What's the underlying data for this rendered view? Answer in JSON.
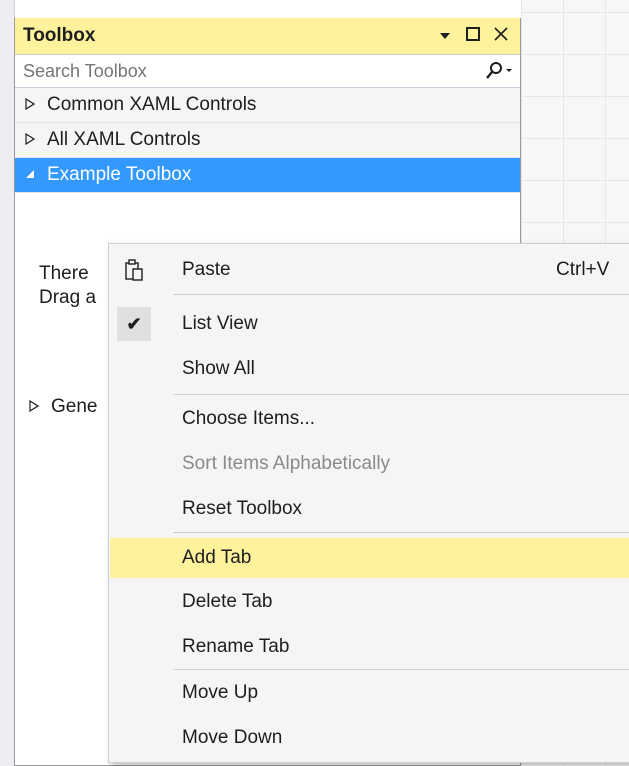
{
  "toolbox": {
    "title": "Toolbox",
    "search_placeholder": "Search Toolbox",
    "groups": [
      {
        "label": "Common XAML Controls",
        "expanded": false
      },
      {
        "label": "All XAML Controls",
        "expanded": false
      },
      {
        "label": "Example Toolbox",
        "expanded": true,
        "selected": true
      }
    ],
    "empty_text_line1": "There",
    "empty_text_line2": "Drag a",
    "general_label": "Gene",
    "colors": {
      "title_bg": "#fff29d",
      "selected_bg": "#3399ff",
      "hover_bg": "#fff29d"
    }
  },
  "context_menu": {
    "items": [
      {
        "label": "Paste",
        "shortcut": "Ctrl+V",
        "icon": "paste-icon"
      },
      {
        "label": "List View",
        "checked": true
      },
      {
        "label": "Show All"
      },
      {
        "label": "Choose Items..."
      },
      {
        "label": "Sort Items Alphabetically",
        "disabled": true
      },
      {
        "label": "Reset Toolbox"
      },
      {
        "label": "Add Tab",
        "highlighted": true
      },
      {
        "label": "Delete Tab"
      },
      {
        "label": "Rename Tab"
      },
      {
        "label": "Move Up"
      },
      {
        "label": "Move Down"
      }
    ]
  }
}
